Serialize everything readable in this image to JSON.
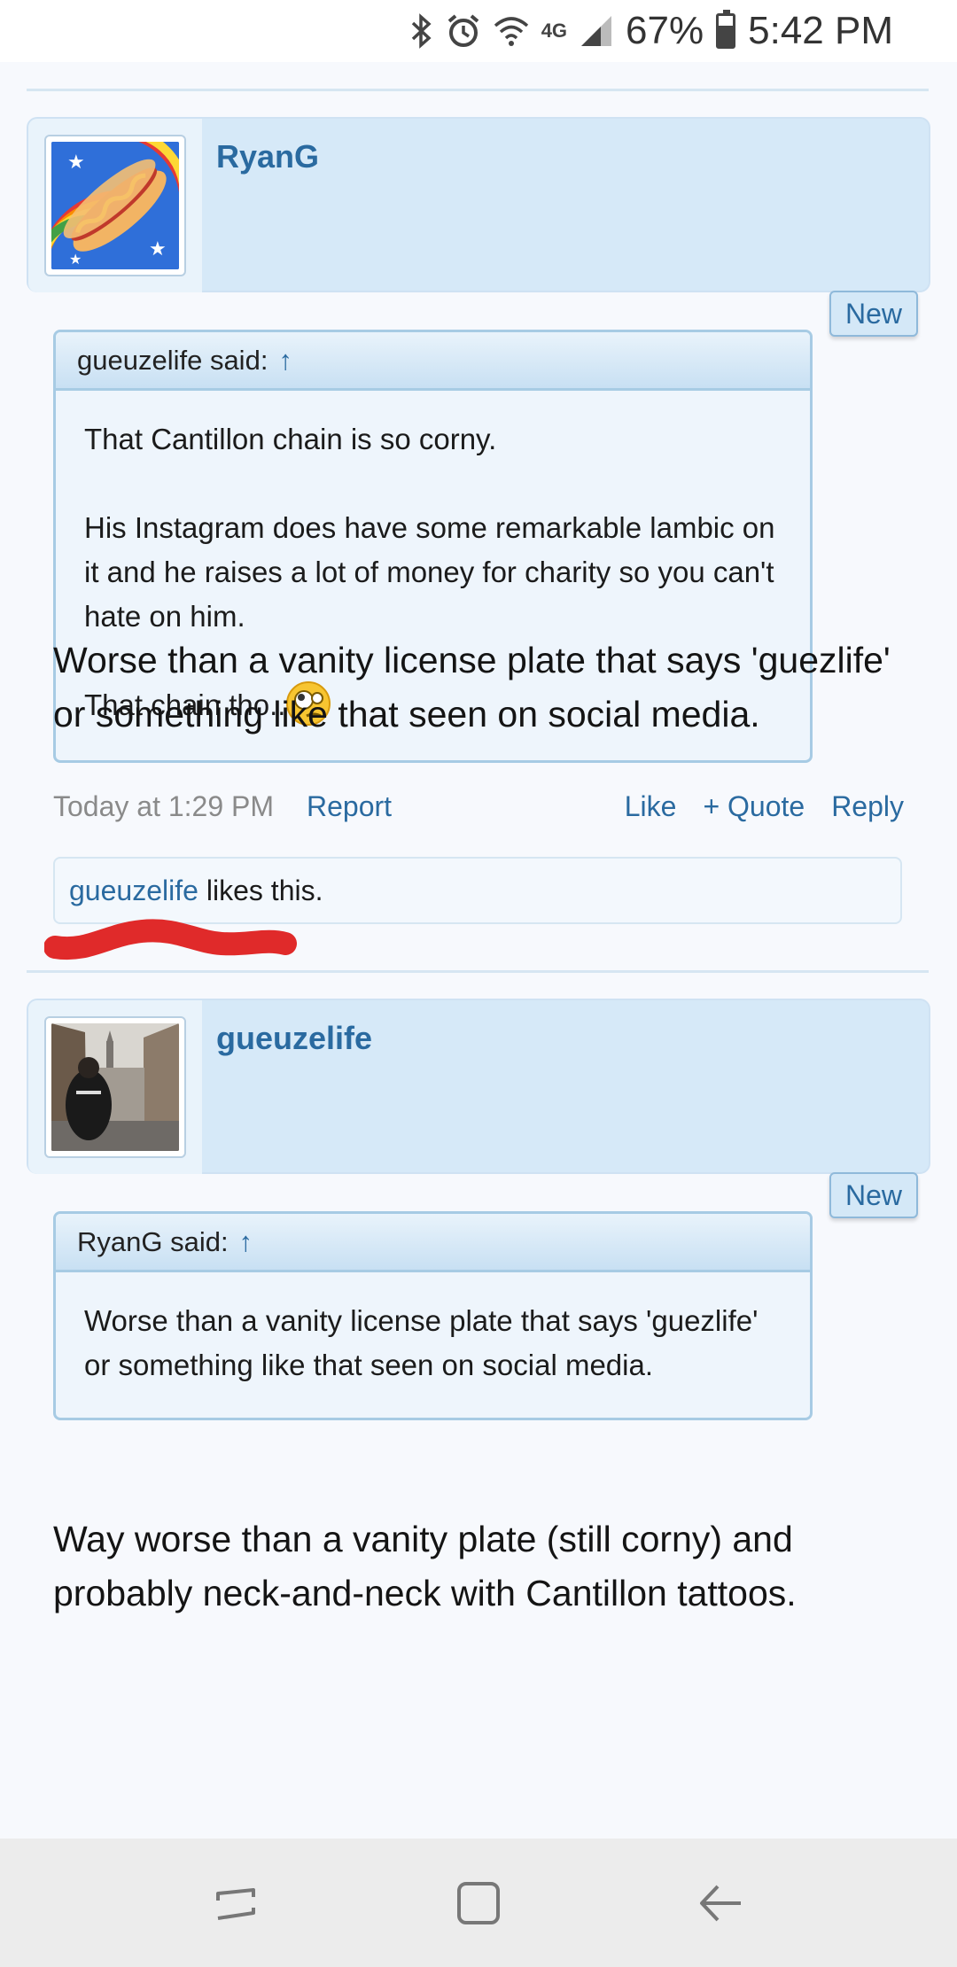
{
  "status_bar": {
    "network": "4G",
    "battery": "67%",
    "time": "5:42 PM"
  },
  "posts": [
    {
      "username": "RyanG",
      "new_badge": "New",
      "quote": {
        "author_said": "gueuzelife said:",
        "arrow": "↑",
        "paragraphs": [
          "That Cantillon chain is so corny.",
          "His Instagram does have some remarkable lambic on it and he raises a lot of money for charity so you can't hate on him.",
          "That chain tho.."
        ]
      },
      "message": "Worse than a vanity license plate that says 'guezlife' or something like that seen on social media.",
      "meta": {
        "date": "Today at 1:29 PM",
        "report": "Report",
        "like": "Like",
        "quote": "+ Quote",
        "reply": "Reply"
      },
      "likes": {
        "liker": "gueuzelife",
        "suffix": "likes this."
      }
    },
    {
      "username": "gueuzelife",
      "new_badge": "New",
      "quote": {
        "author_said": "RyanG said:",
        "arrow": "↑",
        "paragraphs": [
          "Worse than a vanity license plate that says 'guezlife' or something like that seen on social media."
        ]
      },
      "message": "Way worse than a vanity plate (still corny) and probably neck-and-neck with Cantillon tattoos."
    }
  ],
  "colors": {
    "link": "#2a6aa0",
    "header_bg": "#d6e9f8",
    "scribble": "#e02a2a"
  }
}
